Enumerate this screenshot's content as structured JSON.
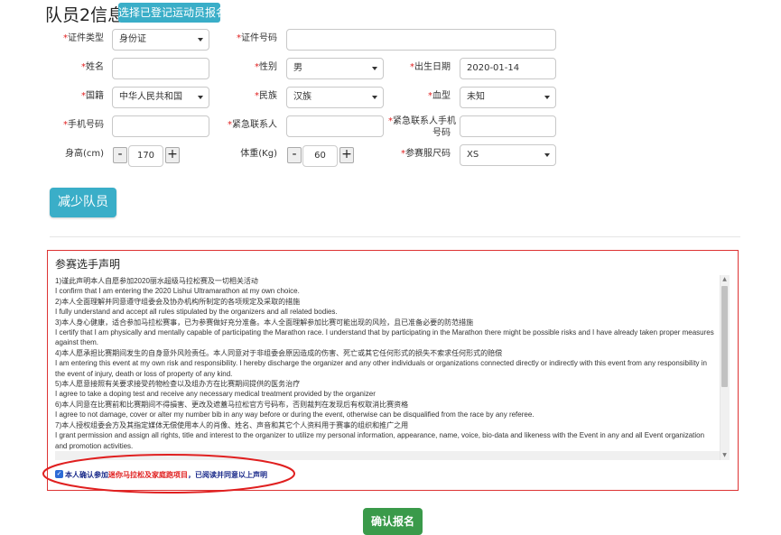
{
  "header": {
    "title": "队员2信息",
    "select_button": "选择已登记运动员报名"
  },
  "form": {
    "id_type": {
      "label": "证件类型",
      "value": "身份证"
    },
    "id_number": {
      "label": "证件号码",
      "value": ""
    },
    "name": {
      "label": "姓名",
      "value": ""
    },
    "gender": {
      "label": "性别",
      "value": "男"
    },
    "birthdate": {
      "label": "出生日期",
      "value": "2020-01-14"
    },
    "nationality": {
      "label": "国籍",
      "value": "中华人民共和国"
    },
    "ethnicity": {
      "label": "民族",
      "value": "汉族"
    },
    "blood_type": {
      "label": "血型",
      "value": "未知"
    },
    "phone": {
      "label": "手机号码",
      "value": ""
    },
    "emergency_contact": {
      "label": "紧急联系人",
      "value": ""
    },
    "emergency_phone": {
      "label_line1": "紧急联系人手机",
      "label_line2": "号码",
      "value": ""
    },
    "height": {
      "label": "身高(cm)",
      "value": "170",
      "minus": "-",
      "plus": "+"
    },
    "weight": {
      "label": "体重(Kg)",
      "value": "60",
      "minus": "-",
      "plus": "+"
    },
    "shirt_size": {
      "label": "参赛服尺码",
      "value": "XS"
    },
    "required_mark": "*"
  },
  "reduce_button": "减少队员",
  "declaration": {
    "title": "参赛选手声明",
    "lines": [
      "1)谨此声明本人自愿参加2020丽水超级马拉松赛及一切相关活动",
      "I confirm that I am entering the 2020 Lishui Ultramarathon at my own choice.",
      "2)本人全面理解并同意遵守组委会及协办机构所制定的各项规定及采取的措施",
      "I fully understand and accept all rules stipulated by the organizers and all related bodies.",
      "3)本人身心健康，适合参加马拉松赛事，已为参赛做好充分准备。本人全面理解参加比赛可能出现的风险，且已准备必要的防范措施",
      "I certify that I am physically and mentally capable of participating the Marathon race. I understand that by participating in the Marathon there might be possible risks and I have already taken proper measures against them.",
      "4)本人愿承担比赛期间发生的自身意外风险责任。本人同意对于非组委会原因造成的伤害、死亡或其它任何形式的损失不索求任何形式的赔偿",
      "I am entering this event at my own risk and responsibility. I hereby discharge the organizer and any other individuals or organizations connected directly or indirectly with this event from any responsibility in the event of injury, death or loss of property of any kind.",
      "5)本人愿意接照有关要求接受药物检查以及组办方在比赛期间提供的医务治疗",
      "I agree to take a doping test and receive any necessary medical treatment provided by the organizer",
      "6)本人同意在比赛前和比赛期间不得損害、更改及遮蓋马拉松官方号码布，否则裁判在发现后有权取消比赛资格",
      "I agree to not damage, cover or alter my number bib in any way before or during the event, otherwise can be disqualified from the race by any referee.",
      "7)本人授权组委会方及其指定媒体无偿使用本人的肖像、姓名、声音和其它个人资料用于赛事的组织和推广之用",
      "I grant permission and assign all rights, title and interest to the organizer to utilize my personal information, appearance, name, voice, bio-data and likeness with the Event in any and all Event organization and promotion activities."
    ],
    "agree_part1": "本人确认参加",
    "agree_part2": "迷你马拉松及家庭跑项目",
    "agree_part3": "，已阅读并同意以上声明"
  },
  "confirm_button": "确认报名",
  "colors": {
    "accent": "#3aaec8",
    "confirm": "#3a9a4a",
    "required": "#e02020",
    "highlight": "#e02020"
  }
}
